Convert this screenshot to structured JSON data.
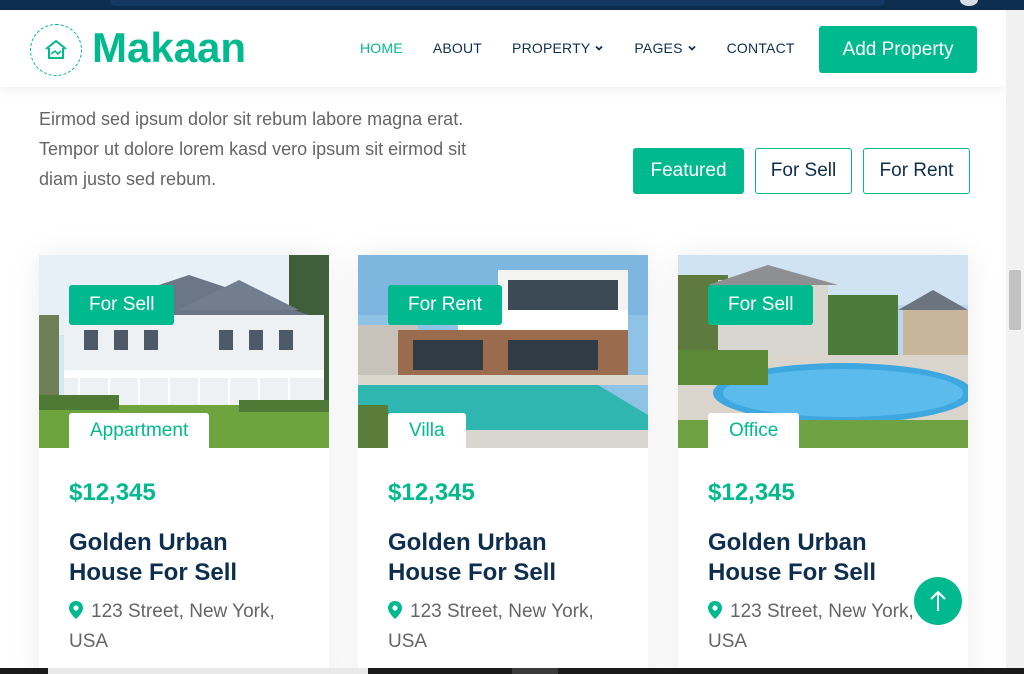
{
  "brand": {
    "name": "Makaan",
    "logo_icon": "house-handshake-icon",
    "accent": "#00b98e",
    "dark": "#0e2e50"
  },
  "nav": {
    "items": [
      {
        "label": "HOME",
        "active": true,
        "dropdown": false
      },
      {
        "label": "ABOUT",
        "active": false,
        "dropdown": false
      },
      {
        "label": "PROPERTY",
        "active": false,
        "dropdown": true
      },
      {
        "label": "PAGES",
        "active": false,
        "dropdown": true
      },
      {
        "label": "CONTACT",
        "active": false,
        "dropdown": false
      }
    ],
    "cta": "Add Property"
  },
  "intro": {
    "text": "Eirmod sed ipsum dolor sit rebum labore magna erat. Tempor ut dolore lorem kasd vero ipsum sit eirmod sit diam justo sed rebum."
  },
  "filters": [
    {
      "label": "Featured",
      "active": true
    },
    {
      "label": "For Sell",
      "active": false
    },
    {
      "label": "For Rent",
      "active": false
    }
  ],
  "listings": [
    {
      "status": "For Sell",
      "type": "Appartment",
      "price": "$12,345",
      "title": "Golden Urban House For Sell",
      "address": "123 Street, New York, USA",
      "image": "colonial-house-photo"
    },
    {
      "status": "For Rent",
      "type": "Villa",
      "price": "$12,345",
      "title": "Golden Urban House For Sell",
      "address": "123 Street, New York, USA",
      "image": "modern-villa-pool-photo"
    },
    {
      "status": "For Sell",
      "type": "Office",
      "price": "$12,345",
      "title": "Golden Urban House For Sell",
      "address": "123 Street, New York, USA",
      "image": "backyard-pool-photo"
    }
  ],
  "icons": {
    "pin": "map-marker-icon",
    "back_to_top": "arrow-up-icon",
    "dropdown": "chevron-down-icon"
  }
}
